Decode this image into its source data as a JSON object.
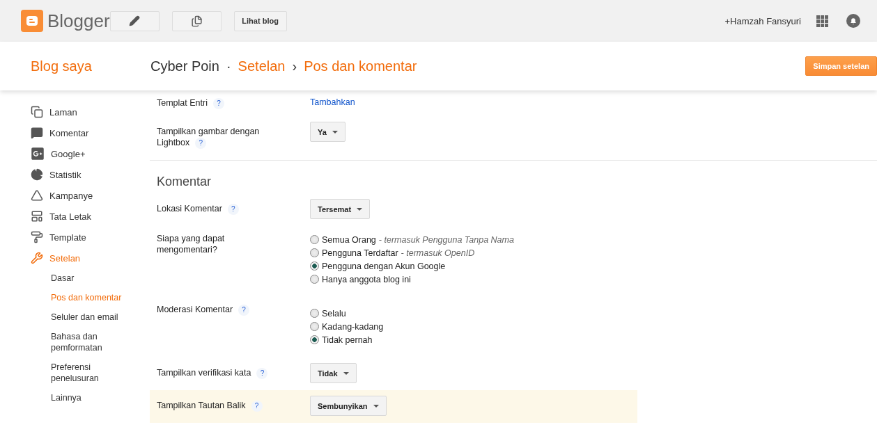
{
  "header": {
    "logo_text": "Blogger",
    "view_blog": "Lihat blog",
    "user": "+Hamzah Fansyuri"
  },
  "nav": {
    "my_blogs": "Blog saya",
    "breadcrumb": [
      {
        "label": "Cyber Poin",
        "kind": "blog"
      },
      {
        "label": "Setelan",
        "kind": "link",
        "sep": "·"
      },
      {
        "label": "Pos dan komentar",
        "kind": "link",
        "sep": "›"
      }
    ],
    "save": "Simpan setelan"
  },
  "sidebar": {
    "items": [
      {
        "label": "Laman",
        "selected": false
      },
      {
        "label": "Komentar",
        "selected": false
      },
      {
        "label": "Google+",
        "selected": false
      },
      {
        "label": "Statistik",
        "selected": false
      },
      {
        "label": "Kampanye",
        "selected": false
      },
      {
        "label": "Tata Letak",
        "selected": false
      },
      {
        "label": "Template",
        "selected": false
      },
      {
        "label": "Setelan",
        "selected": true,
        "children": [
          {
            "label": "Dasar",
            "selected": false
          },
          {
            "label": "Pos dan komentar",
            "selected": true
          },
          {
            "label": "Seluler dan email",
            "selected": false
          },
          {
            "label": "Bahasa dan pemformatan",
            "selected": false
          },
          {
            "label": "Preferensi penelusuran",
            "selected": false
          },
          {
            "label": "Lainnya",
            "selected": false
          }
        ]
      }
    ]
  },
  "settings": [
    {
      "kind": "link",
      "label": "Templat Entri",
      "help": "?",
      "value": "Tambahkan"
    },
    {
      "kind": "dropdown",
      "label": "Tampilkan gambar dengan Lightbox",
      "help": "?",
      "value": "Ya"
    },
    {
      "kind": "section",
      "label": "Komentar"
    },
    {
      "kind": "dropdown",
      "label": "Lokasi Komentar",
      "help": "?",
      "value": "Tersemat"
    },
    {
      "kind": "radio",
      "label": "Siapa yang dapat mengomentari?",
      "options": [
        {
          "label": "Semua Orang",
          "note": "- termasuk Pengguna Tanpa Nama",
          "selected": false
        },
        {
          "label": "Pengguna Terdaftar",
          "note": "- termasuk OpenID",
          "selected": false
        },
        {
          "label": "Pengguna dengan Akun Google",
          "selected": true
        },
        {
          "label": "Hanya anggota blog ini",
          "selected": false
        }
      ]
    },
    {
      "kind": "radio",
      "label": "Moderasi Komentar",
      "help": "?",
      "options": [
        {
          "label": "Selalu",
          "selected": false
        },
        {
          "label": "Kadang-kadang",
          "selected": false
        },
        {
          "label": "Tidak pernah",
          "selected": true
        }
      ]
    },
    {
      "kind": "dropdown",
      "label": "Tampilkan verifikasi kata",
      "help": "?",
      "value": "Tidak"
    },
    {
      "kind": "dropdown",
      "label": "Tampilkan Tautan Balik",
      "help": "?",
      "value": "Sembunyikan",
      "highlighted": true
    }
  ]
}
